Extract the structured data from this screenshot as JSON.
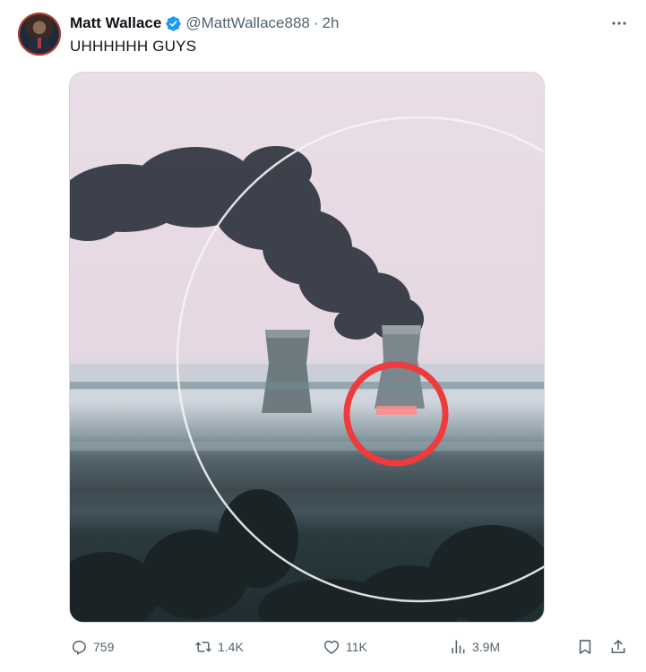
{
  "author": {
    "name": "Matt Wallace",
    "handle": "@MattWallace888",
    "separator": "·",
    "time": "2h"
  },
  "tweet": {
    "text": "UHHHHHH GUYS"
  },
  "actions": {
    "replies": "759",
    "reposts": "1.4K",
    "likes": "11K",
    "views": "3.9M"
  },
  "icons": {
    "verified": "verified-badge-icon",
    "more": "more-icon",
    "reply": "reply-icon",
    "repost": "repost-icon",
    "like": "heart-icon",
    "views": "views-icon",
    "bookmark": "bookmark-icon",
    "share": "share-icon"
  },
  "colors": {
    "verified": "#1d9bf0",
    "secondary_text": "#536471",
    "annotation_circle": "#ef3b3b"
  }
}
